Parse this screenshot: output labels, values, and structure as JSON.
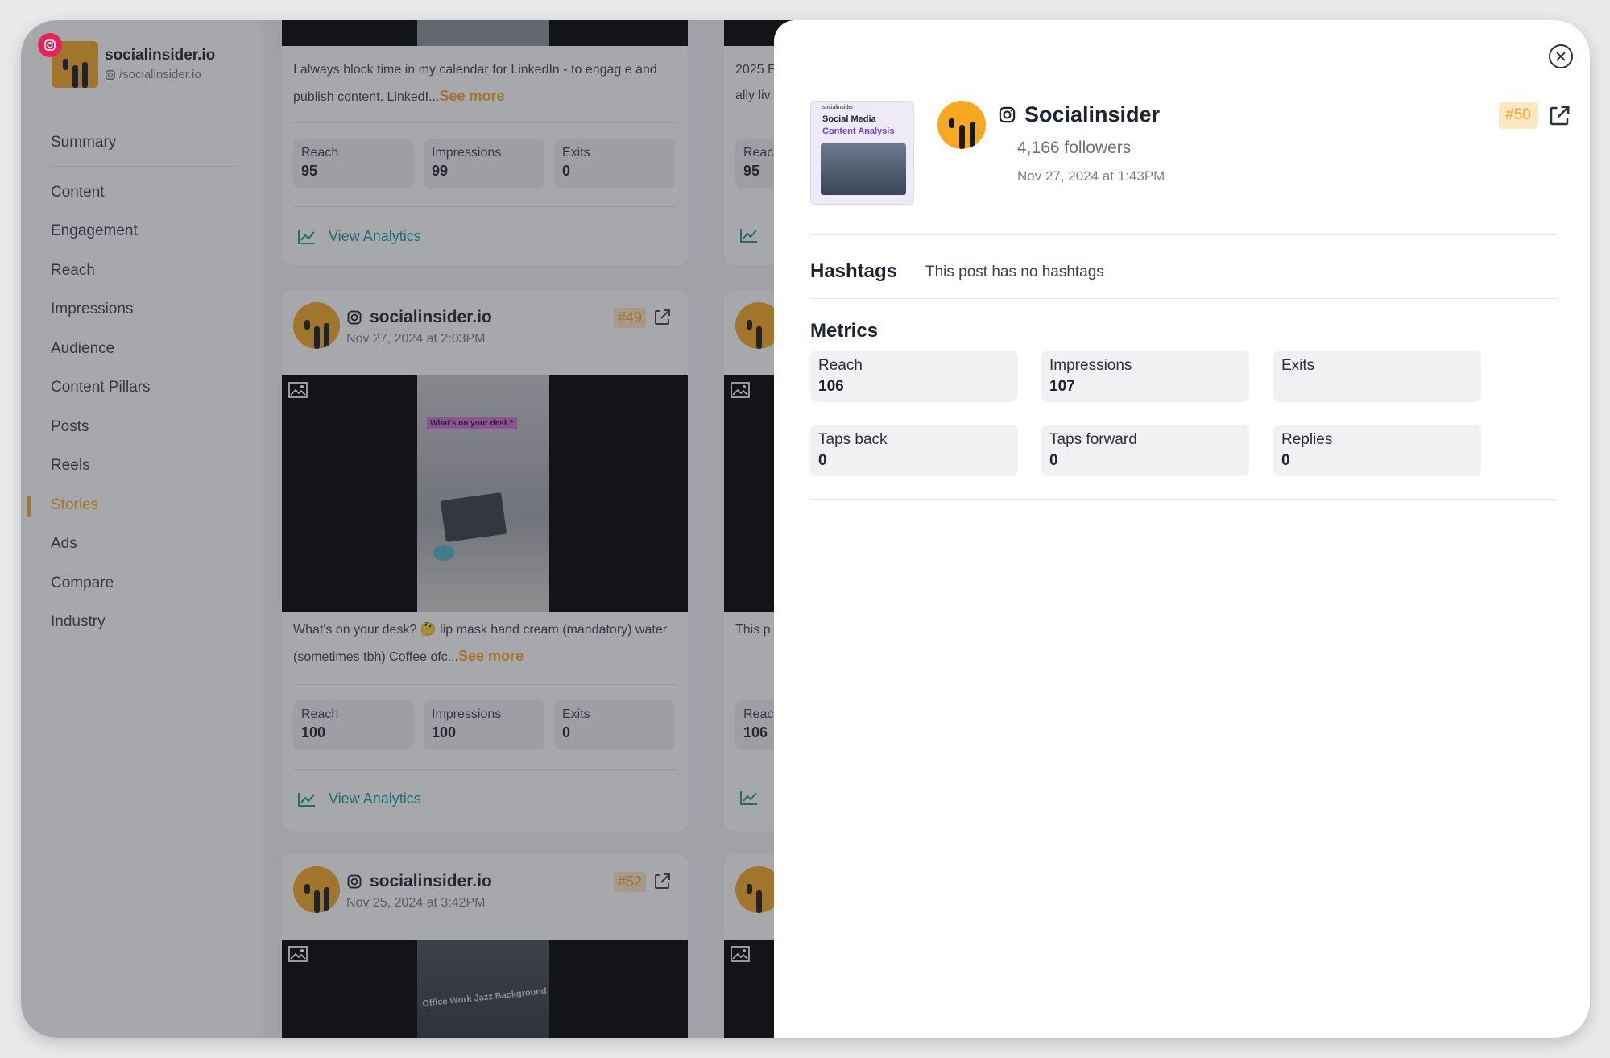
{
  "account": {
    "name": "socialinsider.io",
    "handle": "/socialinsider.io"
  },
  "sidebar": {
    "items": [
      {
        "label": "Summary"
      },
      {
        "label": "Content"
      },
      {
        "label": "Engagement"
      },
      {
        "label": "Reach"
      },
      {
        "label": "Impressions"
      },
      {
        "label": "Audience"
      },
      {
        "label": "Content Pillars"
      },
      {
        "label": "Posts"
      },
      {
        "label": "Reels"
      },
      {
        "label": "Stories"
      },
      {
        "label": "Ads"
      },
      {
        "label": "Compare"
      },
      {
        "label": "Industry"
      }
    ],
    "active": "Stories"
  },
  "feed": {
    "view_analytics": "View Analytics",
    "see_more": "See more",
    "posts": [
      {
        "caption": "I always block time in my calendar for LinkedIn - to engag e and publish content. LinkedI...",
        "metrics": [
          {
            "label": "Reach",
            "value": "95"
          },
          {
            "label": "Impressions",
            "value": "99"
          },
          {
            "label": "Exits",
            "value": "0"
          }
        ]
      },
      {
        "account": "socialinsider.io",
        "date": "Nov 27, 2024 at 2:03PM",
        "rank": "#49",
        "media_text": "What's on your desk?",
        "caption": "What's on your desk? 🤔 lip mask hand cream (mandatory) water (sometimes tbh) Coffee ofc...",
        "metrics": [
          {
            "label": "Reach",
            "value": "100"
          },
          {
            "label": "Impressions",
            "value": "100"
          },
          {
            "label": "Exits",
            "value": "0"
          }
        ]
      },
      {
        "account": "socialinsider.io",
        "date": "Nov 25, 2024 at 3:42PM",
        "rank": "#52",
        "media_text": "Office Work Jazz Background"
      }
    ],
    "right_column": {
      "top_caption": "2025 E",
      "top_caption2": "ally liv",
      "top_reach_label": "Reac",
      "top_reach_value": "95",
      "mid_caption": "This p",
      "mid_reach_label": "Reac",
      "mid_reach_value": "106"
    }
  },
  "detail": {
    "preview": {
      "logo": "socialinsider",
      "title": "Social Media",
      "subtitle": "Content Analysis"
    },
    "name": "Socialinsider",
    "followers": "4,166 followers",
    "date": "Nov 27, 2024 at 1:43PM",
    "rank": "#50",
    "hashtags_title": "Hashtags",
    "hashtags_text": "This post has no hashtags",
    "metrics_title": "Metrics",
    "metrics": [
      {
        "label": "Reach",
        "value": "106"
      },
      {
        "label": "Impressions",
        "value": "107"
      },
      {
        "label": "Exits",
        "value": ""
      },
      {
        "label": "Taps back",
        "value": "0"
      },
      {
        "label": "Taps forward",
        "value": "0"
      },
      {
        "label": "Replies",
        "value": "0"
      }
    ]
  },
  "colors": {
    "accent": "#f7a823",
    "teal": "#1e9a93",
    "instagram": "#e0245e"
  },
  "icons": [
    "instagram-icon",
    "external-link-icon",
    "image-icon",
    "chart-line-icon",
    "close-icon"
  ]
}
